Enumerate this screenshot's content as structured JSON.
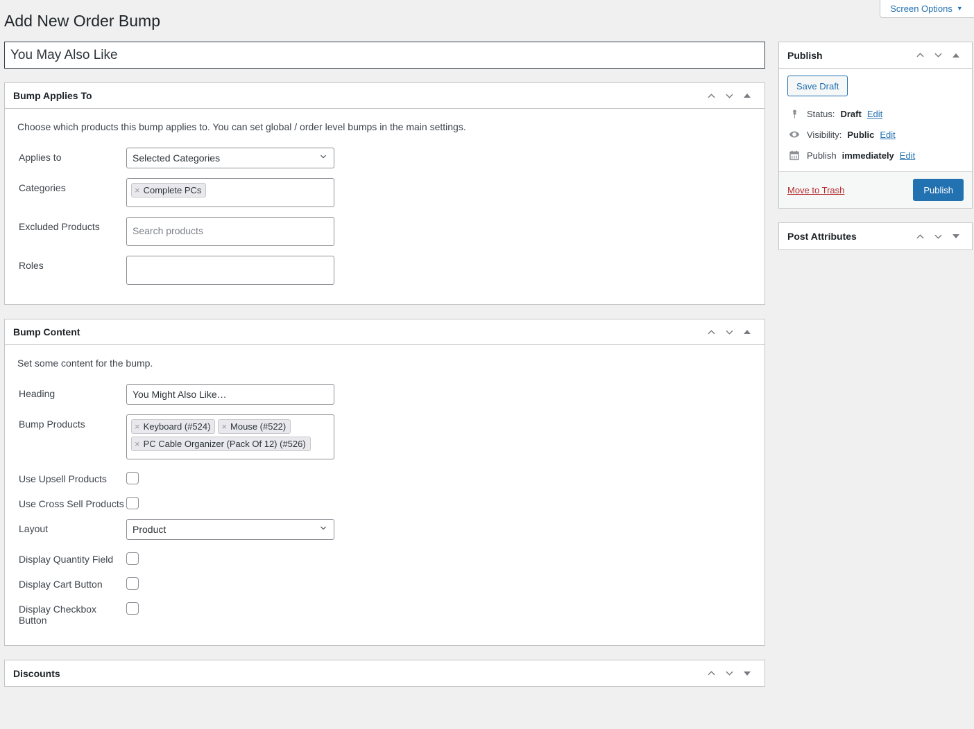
{
  "screen_options": {
    "label": "Screen Options",
    "caret": "▼",
    "icon": "chevron-down-icon"
  },
  "page": {
    "title": "Add New Order Bump"
  },
  "title_field": {
    "value": "You May Also Like",
    "placeholder": "Add title"
  },
  "metaboxes": {
    "bump_applies_to": {
      "title": "Bump Applies To",
      "description": "Choose which products this bump applies to. You can set global / order level bumps in the main settings.",
      "fields": {
        "applies_to": {
          "label": "Applies to",
          "value": "Selected Categories",
          "options": [
            "Selected Categories"
          ]
        },
        "categories": {
          "label": "Categories",
          "tokens": [
            {
              "remove": "×",
              "label": "Complete PCs"
            }
          ]
        },
        "excluded_products": {
          "label": "Excluded Products",
          "placeholder": "Search products",
          "value": ""
        },
        "roles": {
          "label": "Roles",
          "tokens": []
        }
      }
    },
    "bump_content": {
      "title": "Bump Content",
      "description": "Set some content for the bump.",
      "fields": {
        "heading": {
          "label": "Heading",
          "value": "You Might Also Like…"
        },
        "bump_products": {
          "label": "Bump Products",
          "tokens": [
            {
              "remove": "×",
              "label": "Keyboard (#524)"
            },
            {
              "remove": "×",
              "label": "Mouse (#522)"
            },
            {
              "remove": "×",
              "label": "PC Cable Organizer (Pack Of 12) (#526)"
            }
          ]
        },
        "use_upsell_products": {
          "label": "Use Upsell Products",
          "checked": false
        },
        "use_cross_sell_products": {
          "label": "Use Cross Sell Products",
          "checked": false
        },
        "layout": {
          "label": "Layout",
          "value": "Product",
          "options": [
            "Product"
          ]
        },
        "display_quantity_field": {
          "label": "Display Quantity Field",
          "checked": false
        },
        "display_cart_button": {
          "label": "Display Cart Button",
          "checked": false
        },
        "display_checkbox_button": {
          "label": "Display Checkbox Button",
          "checked": false
        }
      }
    },
    "discounts": {
      "title": "Discounts",
      "collapsed": true
    }
  },
  "sidebar": {
    "publish": {
      "title": "Publish",
      "save_draft_label": "Save Draft",
      "rows": [
        {
          "icon": "pin-icon",
          "prefix": "Status:",
          "value": "Draft",
          "edit": "Edit"
        },
        {
          "icon": "eye-icon",
          "prefix": "Visibility:",
          "value": "Public",
          "edit": "Edit"
        },
        {
          "icon": "calendar-icon",
          "prefix": "Publish",
          "value": "immediately",
          "edit": "Edit"
        }
      ],
      "trash_label": "Move to Trash",
      "publish_label": "Publish"
    },
    "post_attributes": {
      "title": "Post Attributes",
      "collapsed": true
    }
  },
  "colors": {
    "accent": "#2271b1",
    "page_bg": "#f0f0f1",
    "box_border": "#c3c4c7",
    "trash": "#b32d2e"
  }
}
